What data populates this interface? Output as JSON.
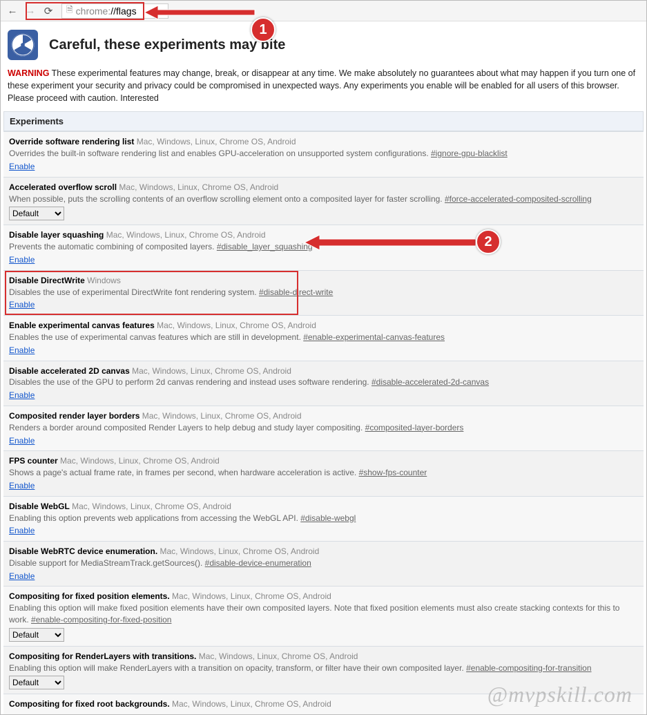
{
  "browser": {
    "url_text": "chrome://flags",
    "url_prefix": "chrome:",
    "url_suffix": "//flags"
  },
  "page": {
    "title": "Careful, these experiments may bite",
    "warning_label": "WARNING",
    "warning_text": " These experimental features may change, break, or disappear at any time. We make absolutely no guarantees about what may happen if you turn one of these experiment your security and privacy could be compromised in unexpected ways. Any experiments you enable will be enabled for all users of this browser. Please proceed with caution. Interested",
    "section_head": "Experiments",
    "enable_label": "Enable",
    "default_label": "Default"
  },
  "experiments": [
    {
      "title": "Override software rendering list",
      "platforms": "Mac, Windows, Linux, Chrome OS, Android",
      "desc": "Overrides the built-in software rendering list and enables GPU-acceleration on unsupported system configurations. ",
      "anchor": "#ignore-gpu-blacklist",
      "control": "enable"
    },
    {
      "title": "Accelerated overflow scroll",
      "platforms": "Mac, Windows, Linux, Chrome OS, Android",
      "desc": "When possible, puts the scrolling contents of an overflow scrolling element onto a composited layer for faster scrolling. ",
      "anchor": "#force-accelerated-composited-scrolling",
      "control": "select"
    },
    {
      "title": "Disable layer squashing",
      "platforms": "Mac, Windows, Linux, Chrome OS, Android",
      "desc": "Prevents the automatic combining of composited layers. ",
      "anchor": "#disable_layer_squashing",
      "control": "enable"
    },
    {
      "title": "Disable DirectWrite",
      "platforms": "Windows",
      "desc": "Disables the use of experimental DirectWrite font rendering system. ",
      "anchor": "#disable-direct-write",
      "control": "enable",
      "highlighted": true
    },
    {
      "title": "Enable experimental canvas features",
      "platforms": "Mac, Windows, Linux, Chrome OS, Android",
      "desc": "Enables the use of experimental canvas features which are still in development. ",
      "anchor": "#enable-experimental-canvas-features",
      "control": "enable"
    },
    {
      "title": "Disable accelerated 2D canvas",
      "platforms": "Mac, Windows, Linux, Chrome OS, Android",
      "desc": "Disables the use of the GPU to perform 2d canvas rendering and instead uses software rendering. ",
      "anchor": "#disable-accelerated-2d-canvas",
      "control": "enable"
    },
    {
      "title": "Composited render layer borders",
      "platforms": "Mac, Windows, Linux, Chrome OS, Android",
      "desc": "Renders a border around composited Render Layers to help debug and study layer compositing. ",
      "anchor": "#composited-layer-borders",
      "control": "enable"
    },
    {
      "title": "FPS counter",
      "platforms": "Mac, Windows, Linux, Chrome OS, Android",
      "desc": "Shows a page's actual frame rate, in frames per second, when hardware acceleration is active. ",
      "anchor": "#show-fps-counter",
      "control": "enable"
    },
    {
      "title": "Disable WebGL",
      "platforms": "Mac, Windows, Linux, Chrome OS, Android",
      "desc": "Enabling this option prevents web applications from accessing the WebGL API. ",
      "anchor": "#disable-webgl",
      "control": "enable"
    },
    {
      "title": "Disable WebRTC device enumeration.",
      "platforms": "Mac, Windows, Linux, Chrome OS, Android",
      "desc": "Disable support for MediaStreamTrack.getSources(). ",
      "anchor": "#disable-device-enumeration",
      "control": "enable"
    },
    {
      "title": "Compositing for fixed position elements.",
      "platforms": "Mac, Windows, Linux, Chrome OS, Android",
      "desc": "Enabling this option will make fixed position elements have their own composited layers. Note that fixed position elements must also create stacking contexts for this to work. ",
      "anchor": "#enable-compositing-for-fixed-position",
      "control": "select"
    },
    {
      "title": "Compositing for RenderLayers with transitions.",
      "platforms": "Mac, Windows, Linux, Chrome OS, Android",
      "desc": "Enabling this option will make RenderLayers with a transition on opacity, transform, or filter have their own composited layer. ",
      "anchor": "#enable-compositing-for-transition",
      "control": "select"
    },
    {
      "title": "Compositing for fixed root backgrounds.",
      "platforms": "Mac, Windows, Linux, Chrome OS, Android",
      "desc": "",
      "anchor": "",
      "control": "none"
    }
  ],
  "annotations": {
    "callout1": "1",
    "callout2": "2",
    "watermark": "@mvpskill.com"
  }
}
